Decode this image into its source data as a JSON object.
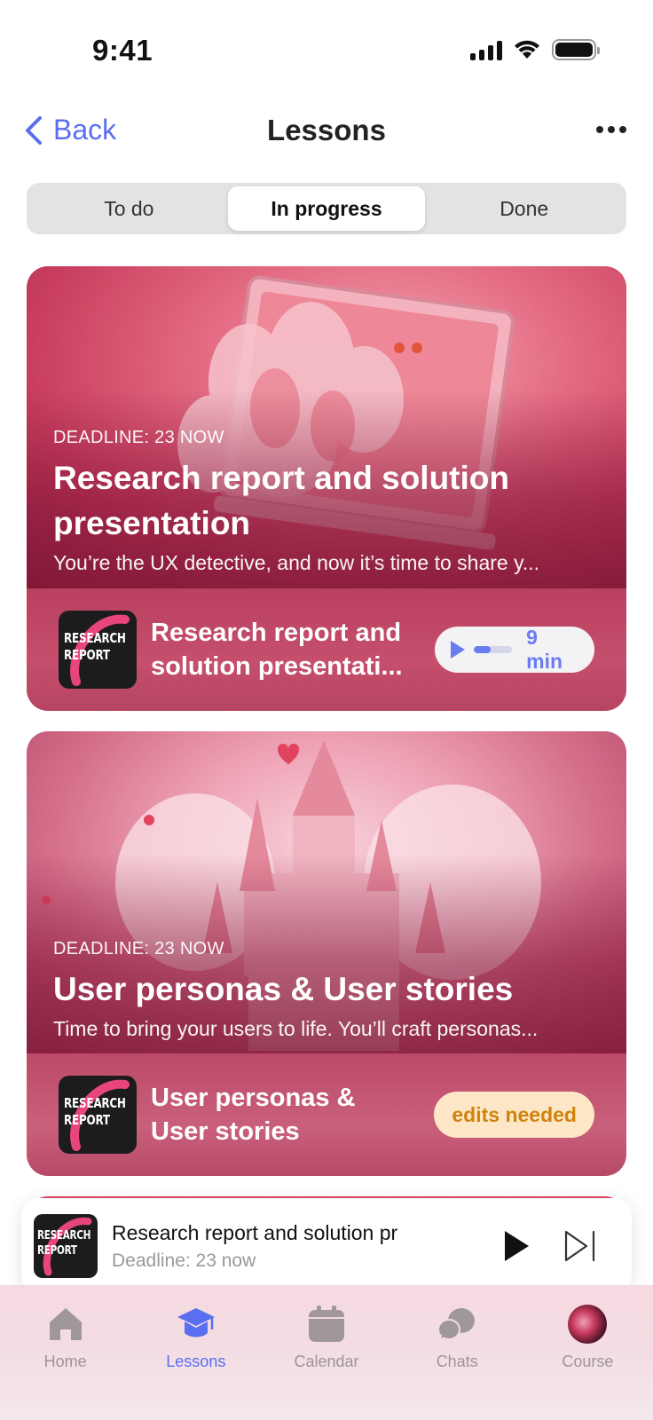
{
  "status_bar": {
    "time": "9:41"
  },
  "nav": {
    "back_label": "Back",
    "title": "Lessons"
  },
  "segments": [
    {
      "label": "To do",
      "active": false
    },
    {
      "label": "In progress",
      "active": true
    },
    {
      "label": "Done",
      "active": false
    }
  ],
  "cards": [
    {
      "deadline": "DEADLINE: 23 NOW",
      "title": "Research report and solution presentation",
      "description": "You’re the UX detective, and now it’s time to share y...",
      "thumb_text": [
        "RESEARCH",
        "REPORT"
      ],
      "footer_title_lines": [
        "Research report and",
        "solution presentati..."
      ],
      "progress": {
        "duration": "9 min",
        "fraction": 0.45
      }
    },
    {
      "deadline": "DEADLINE: 23 NOW",
      "title": "User personas & User stories",
      "description": "Time to bring your users to life. You’ll craft personas...",
      "thumb_text": [
        "RESEARCH",
        "REPORT"
      ],
      "footer_title_lines": [
        "User personas &",
        "User stories"
      ],
      "badge": "edits needed"
    }
  ],
  "mini_player": {
    "title": "Research report and solution pr",
    "subtitle": "Deadline: 23 now",
    "thumb_text": [
      "RESEARCH",
      "REPORT"
    ]
  },
  "tabbar": [
    {
      "label": "Home",
      "icon": "home-icon",
      "active": false
    },
    {
      "label": "Lessons",
      "icon": "graduation-cap-icon",
      "active": true
    },
    {
      "label": "Calendar",
      "icon": "calendar-icon",
      "active": false
    },
    {
      "label": "Chats",
      "icon": "chat-bubbles-icon",
      "active": false
    },
    {
      "label": "Course",
      "icon": "course-avatar",
      "active": false
    }
  ],
  "colors": {
    "accent": "#5a6ef0",
    "badge_bg": "#fde7c6",
    "badge_text": "#d1830f",
    "card_pink": "#c54f6c"
  }
}
